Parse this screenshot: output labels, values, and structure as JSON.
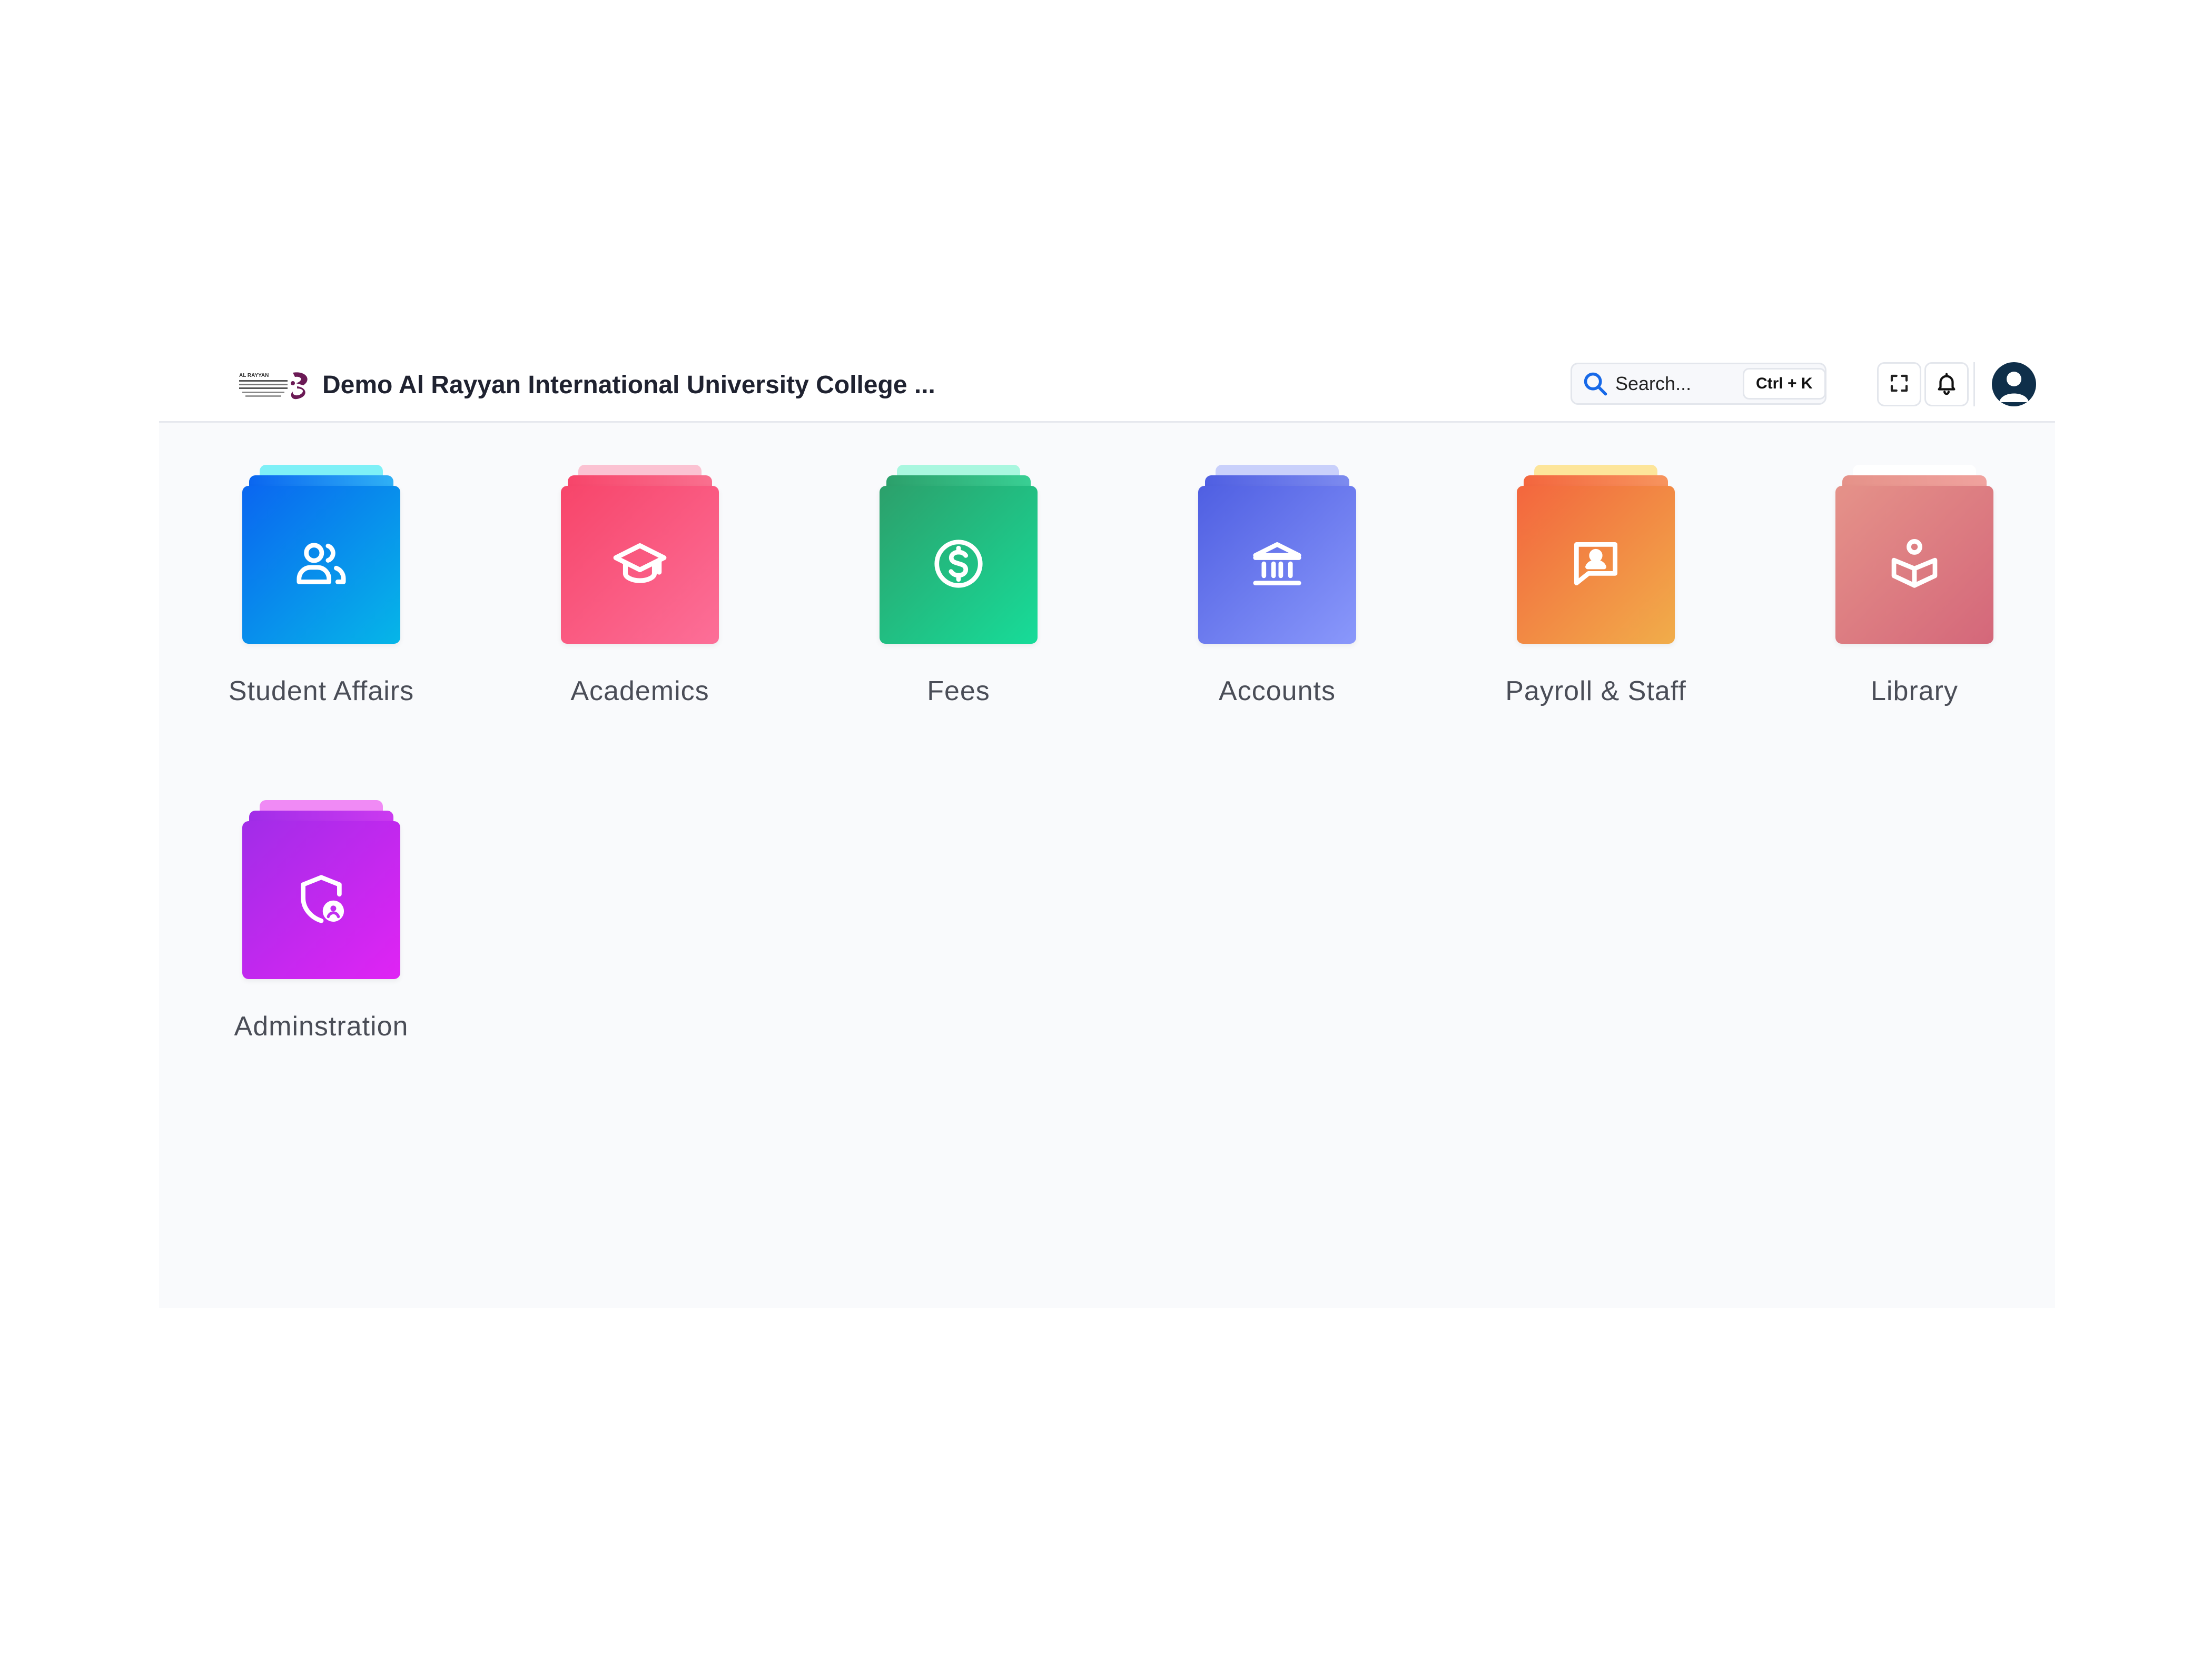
{
  "header": {
    "logo_text_top": "AL RAYYAN",
    "logo_text_mid": "INTERNATIONAL UNIVERSITY COLLEGE",
    "title": "Demo Al Rayyan International University College ...",
    "search_placeholder": "Search...",
    "search_shortcut": "Ctrl + K",
    "icons": {
      "search": "search-icon",
      "fullscreen": "fullscreen-icon",
      "notifications": "bell-icon",
      "profile": "user-avatar-icon"
    }
  },
  "modules": [
    {
      "label": "Student Affairs",
      "icon": "users-icon",
      "color_from": "#0a66f0",
      "color_to": "#06b6e8",
      "stack_mid": "#2fb0f5",
      "stack_top": "#7ef0f7"
    },
    {
      "label": "Academics",
      "icon": "graduation-cap-icon",
      "color_from": "#f7456a",
      "color_to": "#fc6f98",
      "stack_mid": "#f9708f",
      "stack_top": "#fbc2d2"
    },
    {
      "label": "Fees",
      "icon": "dollar-circle-icon",
      "color_from": "#2ca06b",
      "color_to": "#17dc99",
      "stack_mid": "#39cf94",
      "stack_top": "#a9f7df"
    },
    {
      "label": "Accounts",
      "icon": "bank-icon",
      "color_from": "#4f5fe2",
      "color_to": "#8a98fb",
      "stack_mid": "#7d8bef",
      "stack_top": "#c9d0fb"
    },
    {
      "label": "Payroll & Staff",
      "icon": "chat-user-icon",
      "color_from": "#f3663e",
      "color_to": "#f1ad4a",
      "stack_mid": "#f7945e",
      "stack_top": "#fde59a"
    },
    {
      "label": "Library",
      "icon": "book-reader-icon",
      "color_from": "#e59289",
      "color_to": "#d4677a",
      "stack_mid": "#f0a29e",
      "stack_top": "#ffffff"
    },
    {
      "label": "Adminstration",
      "icon": "shield-user-icon",
      "color_from": "#a12de8",
      "color_to": "#e024f4",
      "stack_mid": "#cb3af0",
      "stack_top": "#f08af5"
    }
  ]
}
